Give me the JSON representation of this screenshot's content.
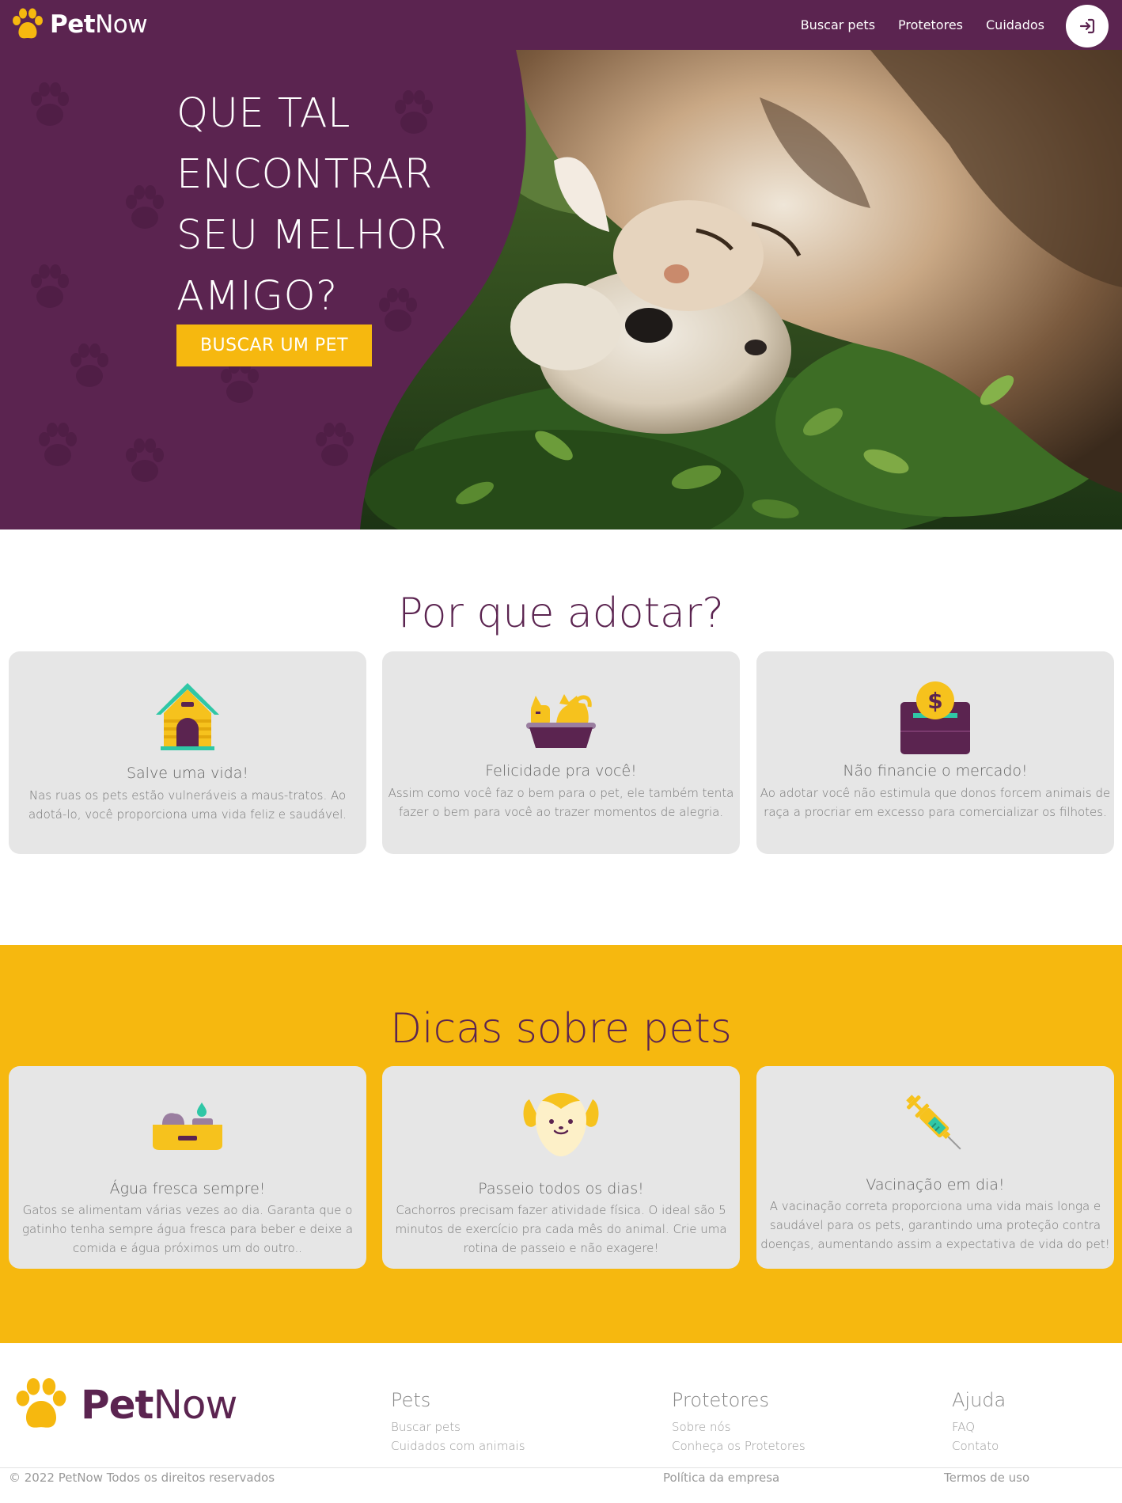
{
  "brand": {
    "name_bold": "Pet",
    "name_rest": "Now"
  },
  "nav": {
    "items": [
      {
        "label": "Buscar pets"
      },
      {
        "label": "Protetores"
      },
      {
        "label": "Cuidados"
      }
    ]
  },
  "hero": {
    "title": "QUE TAL ENCONTRAR SEU MELHOR AMIGO?",
    "button": "BUSCAR UM PET"
  },
  "why_adopt": {
    "title": "Por que adotar?",
    "cards": [
      {
        "icon": "doghouse-icon",
        "title": "Salve uma vida!",
        "text": "Nas ruas os pets estão vulneráveis a maus-tratos. Ao adotá-lo, você proporciona uma vida feliz e saudável."
      },
      {
        "icon": "cat-bed-icon",
        "title": "Felicidade pra você!",
        "text": "Assim como você faz o bem para o pet, ele também tenta fazer o bem para você ao trazer momentos de alegria."
      },
      {
        "icon": "money-box-icon",
        "title": "Não financie o mercado!",
        "text": "Ao adotar você não estimula que donos forcem animais de raça a procriar em excesso para comercializar os filhotes."
      }
    ]
  },
  "tips": {
    "title": "Dicas sobre pets",
    "cards": [
      {
        "icon": "pet-bowl-icon",
        "title": "Água fresca sempre!",
        "text": "Gatos se alimentam várias vezes ao dia. Garanta que o gatinho tenha sempre água fresca para beber e deixe a comida e água próximos um do outro.."
      },
      {
        "icon": "dog-face-icon",
        "title": "Passeio todos os dias!",
        "text": "Cachorros precisam fazer atividade física. O ideal são 5 minutos de exercício pra cada mês do animal. Crie uma rotina de passeio e não exagere!"
      },
      {
        "icon": "syringe-icon",
        "title": "Vacinação em dia!",
        "text": "A vacinação correta proporciona uma vida mais longa e saudável para os pets, garantindo uma proteção contra doenças, aumentando assim a expectativa de vida do pet!"
      }
    ]
  },
  "footer": {
    "columns": [
      {
        "title": "Pets",
        "links": [
          "Buscar pets",
          "Cuidados com animais"
        ]
      },
      {
        "title": "Protetores",
        "links": [
          "Sobre nós",
          "Conheça os Protetores"
        ]
      },
      {
        "title": "Ajuda",
        "links": [
          "FAQ",
          "Contato"
        ]
      }
    ],
    "copyright": "© 2022 PetNow Todos os direitos reservados",
    "policy": "Política da empresa",
    "terms": "Termos de uso"
  },
  "colors": {
    "purple": "#5b2450",
    "yellow": "#f6b80f",
    "card_bg": "#e6e6e6"
  }
}
